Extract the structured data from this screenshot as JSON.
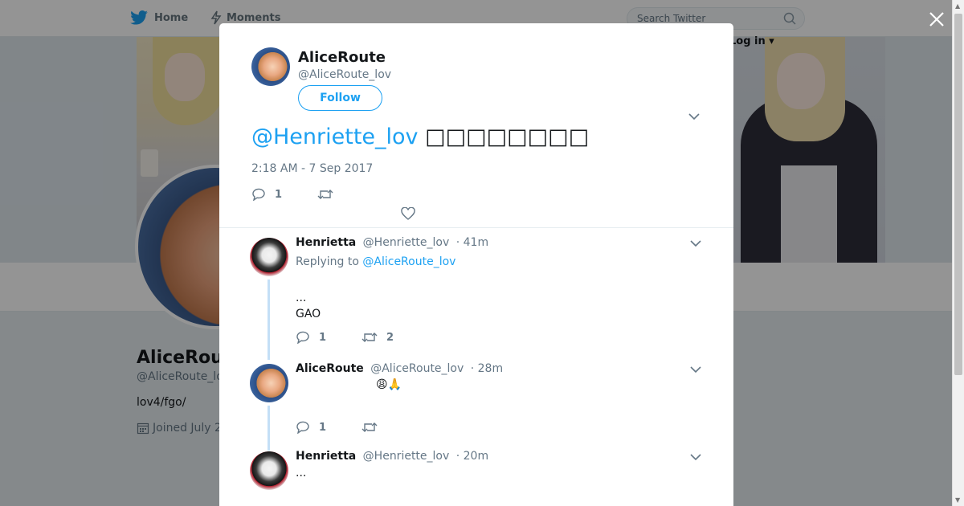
{
  "topnav": {
    "home_label": "Home",
    "moments_label": "Moments",
    "search_placeholder": "Search Twitter",
    "login_label": "Log in"
  },
  "profile": {
    "name": "AliceRoute",
    "handle": "@AliceRoute_lov",
    "bio": "lov4/fgo/",
    "joined": "Joined July 2"
  },
  "main_tweet": {
    "author_name": "AliceRoute",
    "author_handle": "@AliceRoute_lov",
    "follow_label": "Follow",
    "mention": "@Henriette_lov",
    "text": "□□□□□□□□",
    "timestamp": "2:18 AM - 7 Sep 2017",
    "reply_count": "1"
  },
  "replies": [
    {
      "author_name": "Henrietta",
      "author_handle": "@Henriette_lov",
      "time": "· 41m",
      "replying_to_label": "Replying to",
      "replying_to_handle": "@AliceRoute_lov",
      "line1": "...",
      "line2": "GAO",
      "reply_count": "1",
      "retweet_count": "2"
    },
    {
      "author_name": "AliceRoute",
      "author_handle": "@AliceRoute_lov",
      "time": "· 28m",
      "text": "😩🙏",
      "reply_count": "1"
    },
    {
      "author_name": "Henrietta",
      "author_handle": "@Henriette_lov",
      "time": "· 20m",
      "text": "..."
    }
  ],
  "colors": {
    "accent": "#1da1f2",
    "text_primary": "#14171a",
    "text_secondary": "#657786",
    "thread_line": "#c4dff6"
  }
}
